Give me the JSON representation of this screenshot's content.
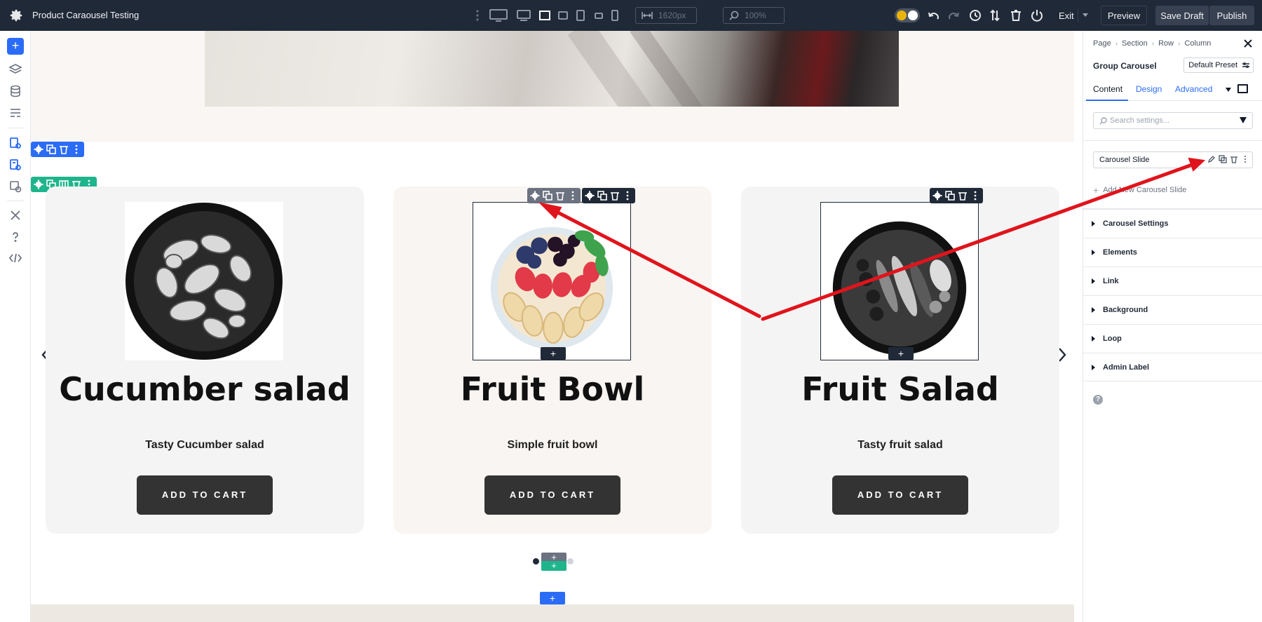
{
  "app": {
    "title": "Product Caraousel Testing"
  },
  "toolbar": {
    "width_value": "1620px",
    "zoom_value": "100%",
    "exit_label": "Exit",
    "preview_label": "Preview",
    "save_draft_label": "Save Draft",
    "publish_label": "Publish"
  },
  "carousel": {
    "cards": [
      {
        "title": "Cucumber salad",
        "subtitle": "Tasty Cucumber salad",
        "button_label": "ADD TO CART",
        "image_icon": "cucumber-salad-bowl-image",
        "background": "#f4f4f4"
      },
      {
        "title": "Fruit Bowl",
        "subtitle": "Simple fruit bowl",
        "button_label": "ADD TO CART",
        "image_icon": "fruit-bowl-image",
        "background": "#f9f5f2"
      },
      {
        "title": "Fruit Salad",
        "subtitle": "Tasty fruit salad",
        "button_label": "ADD TO CART",
        "image_icon": "fruit-salad-bowl-image",
        "background": "#f4f4f4"
      }
    ],
    "active_dot": 0
  },
  "panel": {
    "breadcrumb": [
      "Page",
      "Section",
      "Row",
      "Column"
    ],
    "module_name": "Group Carousel",
    "preset_label": "Default Preset",
    "tabs": [
      "Content",
      "Design",
      "Advanced"
    ],
    "active_tab": "Content",
    "search_placeholder": "Search settings...",
    "slide_item_label": "Carousel Slide",
    "add_slide_label": "Add New Carousel Slide",
    "sections": [
      "Carousel Settings",
      "Elements",
      "Link",
      "Background",
      "Loop",
      "Admin Label"
    ],
    "help_label": "?"
  },
  "colors": {
    "accent_blue": "#2b6cf6",
    "accent_green": "#1fb58c",
    "topbar": "#1f2937",
    "annotation_red": "#e0141c",
    "cart_button": "#333333"
  },
  "icons": {
    "topbar": [
      "settings-gear-icon",
      "kebab-icon",
      "desktop-icon",
      "laptop-icon",
      "tablet-landscape-icon",
      "tablet-portrait-icon",
      "phone-landscape-icon",
      "phone-portrait-icon",
      "width-icon",
      "zoom-icon",
      "theme-toggle-icon",
      "undo-icon",
      "redo-icon",
      "history-icon",
      "sort-icon",
      "trash-icon",
      "power-icon"
    ],
    "leftrail": [
      "add-icon",
      "layers-icon",
      "database-icon",
      "layout-icon",
      "page-settings-icon",
      "page-templates-icon",
      "theme-builder-icon",
      "tools-icon",
      "help-icon",
      "code-icon"
    ]
  }
}
